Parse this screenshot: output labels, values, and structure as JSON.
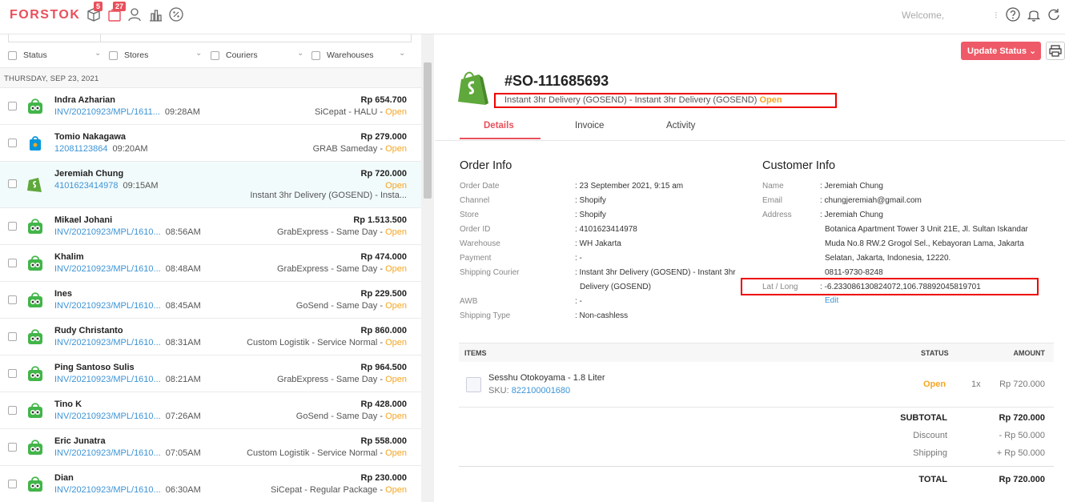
{
  "brand": "FORSTOK",
  "header": {
    "badges": {
      "orders": "5",
      "notifications": "27"
    },
    "welcome": "Welcome,"
  },
  "filters": [
    "Status",
    "Stores",
    "Couriers",
    "Warehouses"
  ],
  "date_group": "THURSDAY, SEP 23, 2021",
  "orders": [
    {
      "name": "Indra Azharian",
      "ref": "INV/20210923/MPL/1611...",
      "time": "09:28AM",
      "amount": "Rp 654.700",
      "courier": "SiCepat - HALU",
      "status": "Open",
      "store": "tokopedia"
    },
    {
      "name": "Tomio Nakagawa",
      "ref": "12081123864",
      "time": "09:20AM",
      "amount": "Rp 279.000",
      "courier": "GRAB Sameday",
      "status": "Open",
      "store": "blibli"
    },
    {
      "name": "Jeremiah Chung",
      "ref": "4101623414978",
      "time": "09:15AM",
      "amount": "Rp 720.000",
      "courier": "Instant 3hr Delivery (GOSEND) - Insta...",
      "status": "Open",
      "store": "shopify"
    },
    {
      "name": "Mikael Johani",
      "ref": "INV/20210923/MPL/1610...",
      "time": "08:56AM",
      "amount": "Rp 1.513.500",
      "courier": "GrabExpress - Same Day",
      "status": "Open",
      "store": "tokopedia"
    },
    {
      "name": "Khalim",
      "ref": "INV/20210923/MPL/1610...",
      "time": "08:48AM",
      "amount": "Rp 474.000",
      "courier": "GrabExpress - Same Day",
      "status": "Open",
      "store": "tokopedia"
    },
    {
      "name": "Ines",
      "ref": "INV/20210923/MPL/1610...",
      "time": "08:45AM",
      "amount": "Rp 229.500",
      "courier": "GoSend - Same Day",
      "status": "Open",
      "store": "tokopedia"
    },
    {
      "name": "Rudy Christanto",
      "ref": "INV/20210923/MPL/1610...",
      "time": "08:31AM",
      "amount": "Rp 860.000",
      "courier": "Custom Logistik - Service Normal",
      "status": "Open",
      "store": "tokopedia"
    },
    {
      "name": "Ping Santoso Sulis",
      "ref": "INV/20210923/MPL/1610...",
      "time": "08:21AM",
      "amount": "Rp 964.500",
      "courier": "GrabExpress - Same Day",
      "status": "Open",
      "store": "tokopedia"
    },
    {
      "name": "Tino K",
      "ref": "INV/20210923/MPL/1610...",
      "time": "07:26AM",
      "amount": "Rp 428.000",
      "courier": "GoSend - Same Day",
      "status": "Open",
      "store": "tokopedia"
    },
    {
      "name": "Eric Junatra",
      "ref": "INV/20210923/MPL/1610...",
      "time": "07:05AM",
      "amount": "Rp 558.000",
      "courier": "Custom Logistik - Service Normal",
      "status": "Open",
      "store": "tokopedia"
    },
    {
      "name": "Dian",
      "ref": "INV/20210923/MPL/1610...",
      "time": "06:30AM",
      "amount": "Rp 230.000",
      "courier": "SiCepat - Regular Package",
      "status": "Open",
      "store": "tokopedia"
    }
  ],
  "detail": {
    "update_button": "Update Status",
    "order_number": "#SO-111685693",
    "courier_line": "Instant 3hr Delivery (GOSEND) - Instant 3hr Delivery (GOSEND)",
    "status": "Open",
    "tabs": [
      "Details",
      "Invoice",
      "Activity"
    ],
    "order_info_title": "Order Info",
    "order_info": [
      {
        "label": "Order Date",
        "value": ": 23 September 2021, 9:15 am"
      },
      {
        "label": "Channel",
        "value": ": Shopify"
      },
      {
        "label": "Store",
        "value": ": Shopify"
      },
      {
        "label": "Order ID",
        "value": ": 4101623414978"
      },
      {
        "label": "Warehouse",
        "value": ": WH Jakarta"
      },
      {
        "label": "Payment",
        "value": ": -"
      },
      {
        "label": "Shipping Courier",
        "value": ": Instant 3hr Delivery (GOSEND) - Instant 3hr",
        "value2": "Delivery (GOSEND)"
      },
      {
        "label": "AWB",
        "value": ": -"
      },
      {
        "label": "Shipping Type",
        "value": ": Non-cashless"
      }
    ],
    "customer_info_title": "Customer Info",
    "customer": {
      "name_label": "Name",
      "name": ": Jeremiah Chung",
      "email_label": "Email",
      "email": ": chungjeremiah@gmail.com",
      "address_label": "Address",
      "address_name": ": Jeremiah Chung",
      "address_1": "Botanica Apartment Tower 3 Unit 21E, Jl. Sultan Iskandar",
      "address_2": "Muda No.8 RW.2 Grogol Sel., Kebayoran Lama, Jakarta",
      "address_3": "Selatan, Jakarta, Indonesia, 12220.",
      "phone": "0811-9730-8248",
      "latlong_label": "Lat / Long",
      "latlong": ": -6.233086130824072,106.78892045819701",
      "edit": "Edit"
    },
    "items_header": {
      "items": "ITEMS",
      "status": "STATUS",
      "amount": "AMOUNT"
    },
    "item": {
      "name": "Sesshu Otokoyama - 1.8 Liter",
      "sku_label": "SKU:",
      "sku": "822100001680",
      "status": "Open",
      "qty": "1x",
      "price": "Rp 720.000"
    },
    "totals": {
      "subtotal_label": "SUBTOTAL",
      "subtotal": "Rp 720.000",
      "discount_label": "Discount",
      "discount": "- Rp 50.000",
      "shipping_label": "Shipping",
      "shipping": "+ Rp 50.000",
      "total_label": "TOTAL",
      "total": "Rp 720.000"
    }
  }
}
